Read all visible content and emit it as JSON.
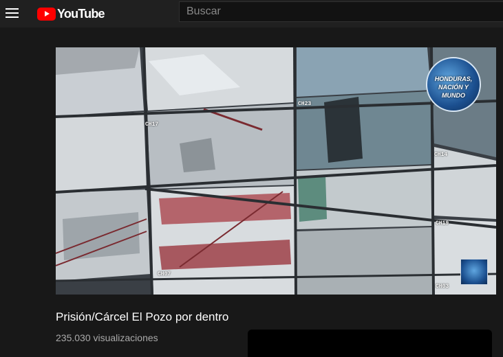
{
  "header": {
    "logo_text": "YouTube",
    "search_placeholder": "Buscar"
  },
  "video": {
    "title": "Prisión/Cárcel El Pozo por dentro",
    "views": "235.030 visualizaciones",
    "channel_labels": [
      "CH17",
      "CH23",
      "CH14",
      "CH07",
      "CH03",
      "CH19"
    ],
    "badge_text": "HONDURAS, NACIÓN Y MUNDO"
  },
  "colors": {
    "page_bg": "#181818",
    "header_bg": "#202020",
    "brand_red": "#ff0000",
    "title_text": "#ffffff",
    "meta_text": "#aaaaaa"
  },
  "icons": {
    "menu": "hamburger-menu-icon",
    "logo": "youtube-play-icon"
  }
}
